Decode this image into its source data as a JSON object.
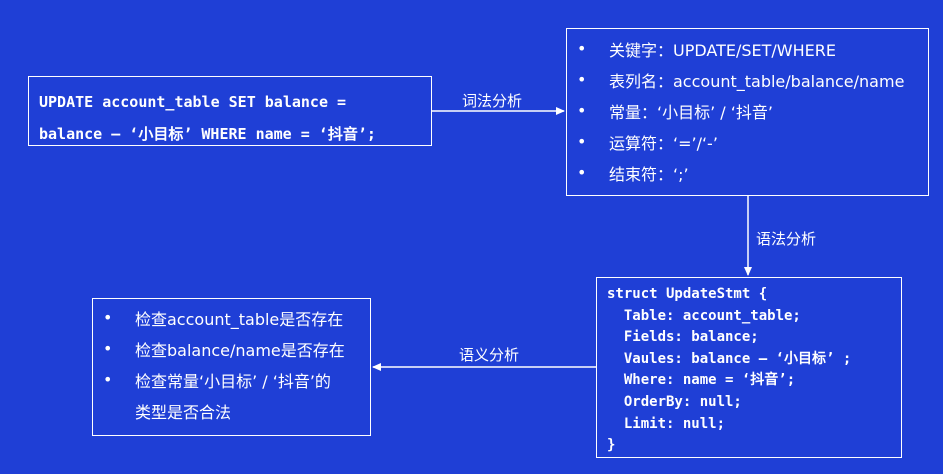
{
  "sql_box": {
    "line1": "UPDATE account_table SET balance =",
    "line2": "balance – ‘小目标’ WHERE name = ‘抖音’;"
  },
  "labels": {
    "lexical": "词法分析",
    "syntax": "语法分析",
    "semantic": "语义分析"
  },
  "lexical_box": {
    "items": [
      "关键字：UPDATE/SET/WHERE",
      "表列名：account_table/balance/name",
      "常量：‘小目标’ / ‘抖音’",
      "运算符：‘=’/‘-’",
      "结束符：‘;’"
    ]
  },
  "struct_box": {
    "lines": [
      "struct UpdateStmt {",
      "  Table: account_table;",
      "  Fields: balance;",
      "  Vaules: balance – ‘小目标’ ;",
      "  Where: name = ‘抖音’;",
      "  OrderBy: null;",
      "  Limit: null;",
      "}"
    ]
  },
  "semantic_box": {
    "items": [
      "检查account_table是否存在",
      "检查balance/name是否存在",
      "检查常量‘小目标’ / ‘抖音’的"
    ],
    "continuation": "类型是否合法"
  },
  "colors": {
    "background": "#1f3fd6",
    "foreground": "#ffffff"
  }
}
